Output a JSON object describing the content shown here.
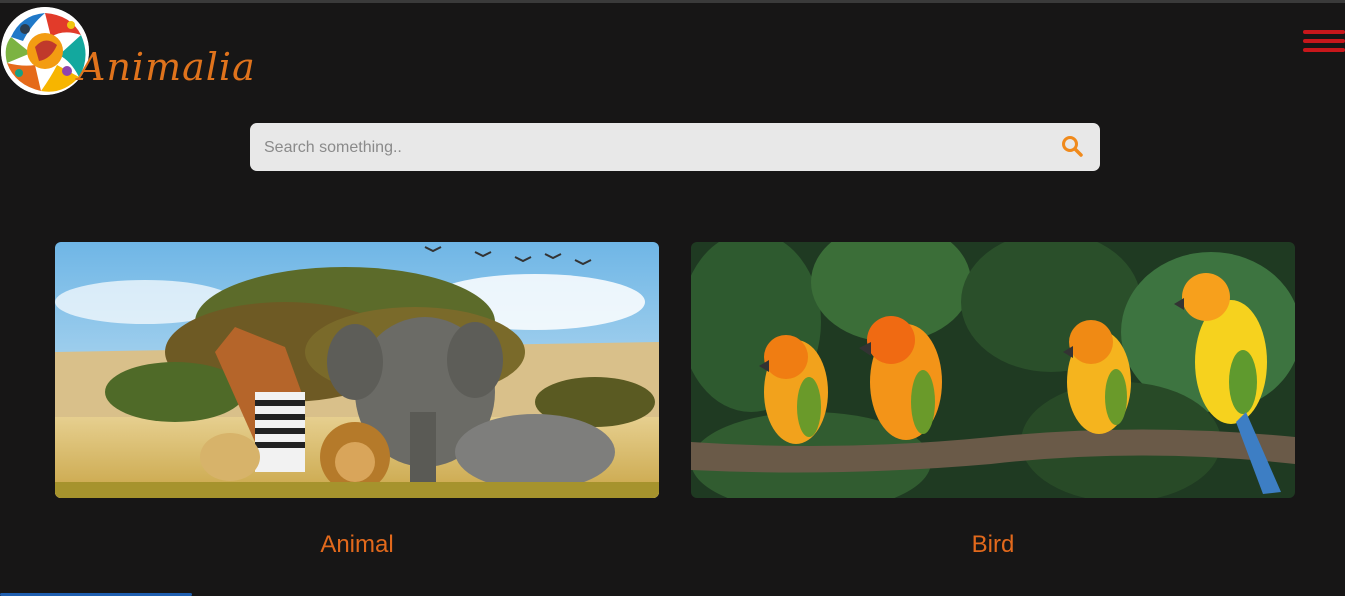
{
  "header": {
    "brand": "Animalia",
    "logo_icon": "colorful-animal-collage-logo",
    "menu_icon": "hamburger-menu-icon",
    "menu_color": "#c8171b",
    "accent_color": "#e0731c"
  },
  "search": {
    "placeholder": "Search something..",
    "icon": "search-icon",
    "icon_color": "#f08a1c"
  },
  "cards": [
    {
      "title": "Animal",
      "image": "savanna-animals-photo"
    },
    {
      "title": "Bird",
      "image": "parrots-on-branch-photo"
    }
  ]
}
